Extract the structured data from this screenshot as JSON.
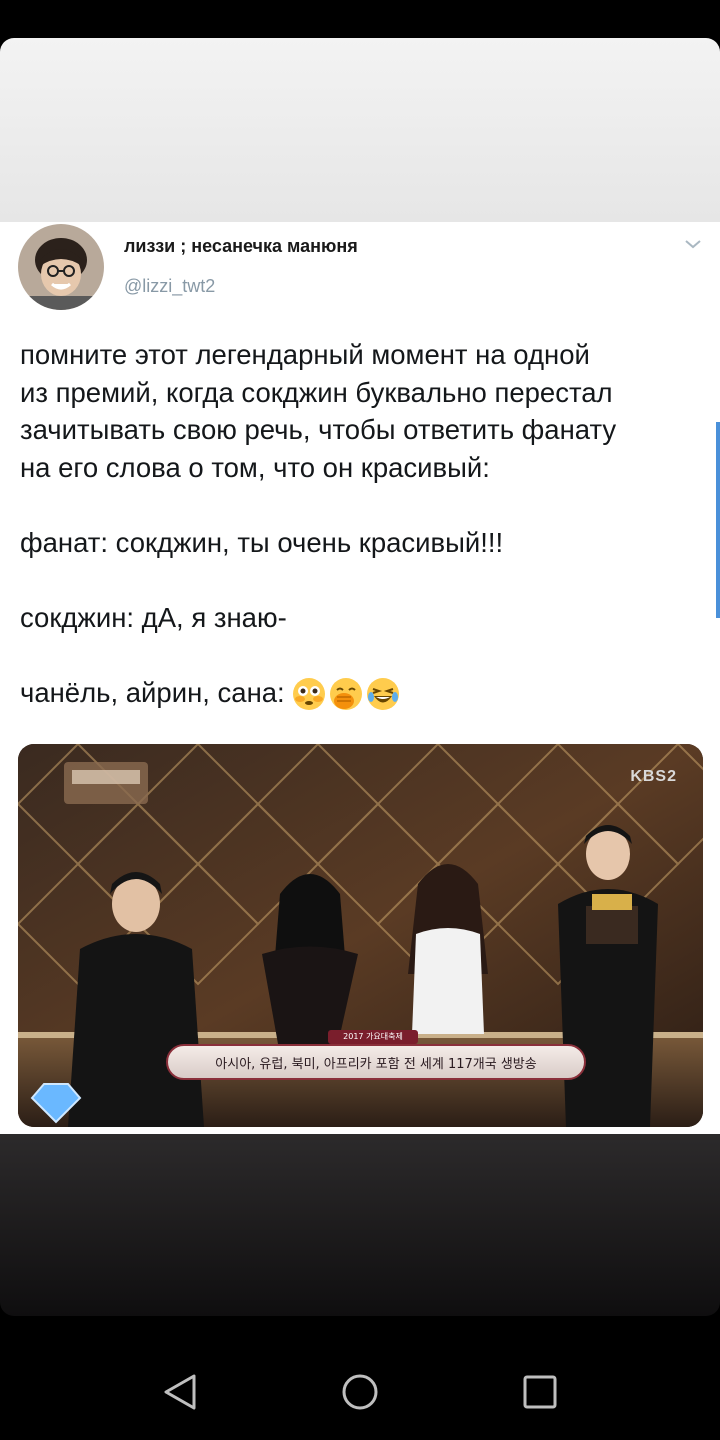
{
  "tweet": {
    "display_name": "лиззи ; несанечка манюня",
    "handle": "@lizzi_twt2",
    "text_lines": {
      "p1_l1": "помните этот легендарный момент на одной",
      "p1_l2": "из премий, когда сокджин буквально перестал",
      "p1_l3": "зачитывать свою речь, чтобы ответить фанату",
      "p1_l4": "на его слова о том, что он красивый:",
      "p2": "фанат: сокджин, ты очень красивый!!!",
      "p3": "сокджин: дА, я знаю-",
      "p4": "чанёль, айрин, сана:"
    },
    "emojis": [
      "flushed-face-emoji",
      "face-with-hand-over-mouth-emoji",
      "rolling-on-floor-laughing-emoji"
    ]
  },
  "media": {
    "watermark": "KBS2",
    "ticker_text": "아시아, 유럽, 북미, 아프리카 포함 전 세계 117개국 생방송",
    "ticker_badge": "2017 가요대축제"
  },
  "nav": {
    "icons": [
      "back-icon",
      "home-icon",
      "recents-icon"
    ]
  },
  "colors": {
    "text": "#14171a",
    "handle": "#8899a6",
    "accent": "#4a90d9"
  }
}
